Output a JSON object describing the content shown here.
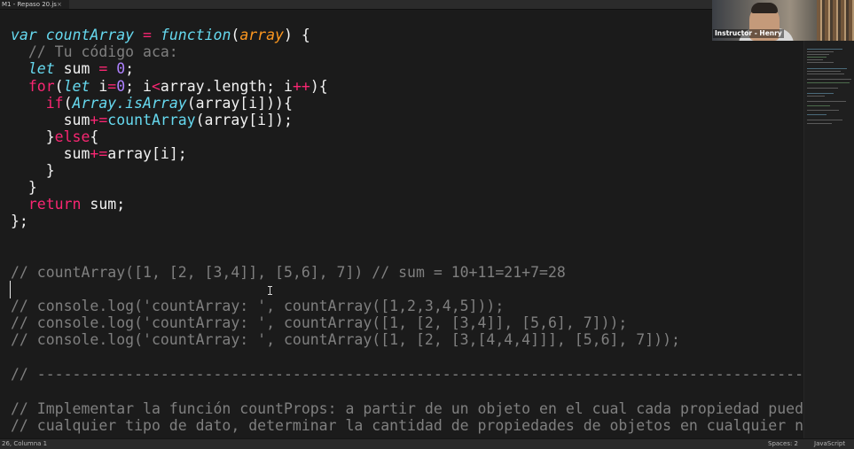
{
  "tab": {
    "title": "M1 - Repaso 20.js",
    "close_glyph": "×"
  },
  "code": {
    "l1": {
      "kw_var": "var",
      "name": " countArray ",
      "eq": "=",
      "kw_function": " function",
      "paren_open": "(",
      "arg": "array",
      "rest": ") {"
    },
    "l2": {
      "comment": "  // Tu código aca:"
    },
    "l3": {
      "kw_let": "  let",
      "name": " sum ",
      "eq": "=",
      "num": " 0",
      "rest": ";"
    },
    "l4": {
      "kw_for": "  for",
      "open": "(",
      "kw_let": "let",
      "i": " i",
      "eq": "=",
      "zero": "0",
      "mid": "; i",
      "lt": "<",
      "mid2": "array.length; i",
      "inc": "++",
      "rest": "){"
    },
    "l5": {
      "kw_if": "    if",
      "open": "(",
      "cls": "Array",
      "method": ".isArray",
      "rest": "(array[i])){"
    },
    "l6": {
      "pre": "      sum",
      "op": "+=",
      "call": "countArray",
      "rest": "(array[i]);"
    },
    "l7": {
      "pre": "    }",
      "kw_else": "else",
      "rest": "{"
    },
    "l8": {
      "pre": "      sum",
      "op": "+=",
      "rest": "array[i];"
    },
    "l9": {
      "text": "    }"
    },
    "l10": {
      "text": "  }"
    },
    "l11": {
      "kw_return": "  return",
      "rest": " sum;"
    },
    "l12": {
      "text": "};"
    },
    "l15": {
      "comment": "// countArray([1, [2, [3,4]], [5,6], 7]) // sum = 10+11=21+7=28"
    },
    "l17": {
      "comment": "// console.log('countArray: ', countArray([1,2,3,4,5]));"
    },
    "l18": {
      "comment": "// console.log('countArray: ', countArray([1, [2, [3,4]], [5,6], 7]));"
    },
    "l19": {
      "comment": "// console.log('countArray: ', countArray([1, [2, [3,[4,4,4]]], [5,6], 7]));"
    },
    "l21": {
      "comment": "// ---------------------------------------------------------------------------------------------"
    },
    "l23": {
      "comment": "// Implementar la función countProps: a partir de un objeto en el cual cada propiedad puede c"
    },
    "l24": {
      "comment": "// cualquier tipo de dato, determinar la cantidad de propiedades de objetos en cualquier nive"
    }
  },
  "webcam": {
    "label": "Instructor - Henry"
  },
  "statusbar": {
    "position": "26, Columna 1",
    "spaces": "Spaces: 2",
    "language": "JavaScript"
  },
  "colors": {
    "background": "#1b1b1b",
    "keyword": "#66d9ef",
    "operator": "#f92672",
    "number": "#ae81ff",
    "argument": "#fd971f",
    "comment": "#7f7f7f",
    "text": "#f2f2f2"
  }
}
